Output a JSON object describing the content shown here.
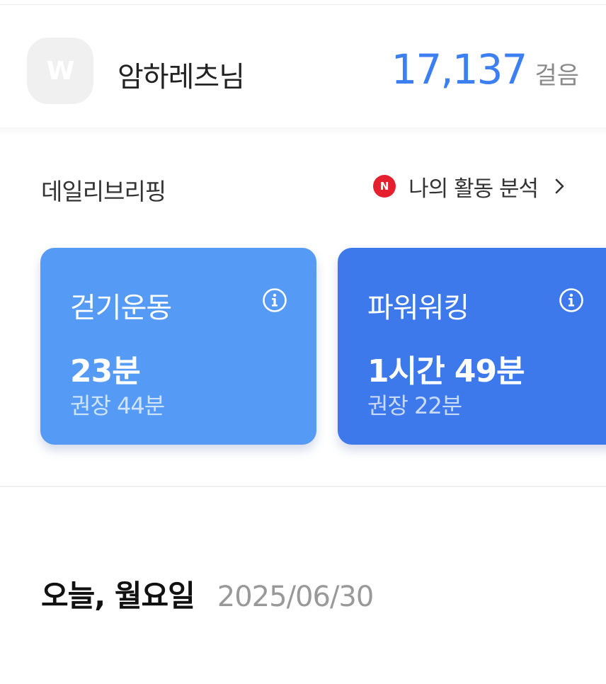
{
  "profile": {
    "avatar_letter": "W",
    "username": "암하레츠님",
    "steps_value": "17,137",
    "steps_unit": "걸음"
  },
  "briefing": {
    "title": "데일리브리핑",
    "badge": "N",
    "analysis_label": "나의 활동 분석"
  },
  "cards": [
    {
      "title": "걷기운동",
      "value": "23분",
      "recommended": "권장 44분",
      "color": "#559bf5"
    },
    {
      "title": "파워워킹",
      "value": "1시간 49분",
      "recommended": "권장 22분",
      "color": "#3d79ea"
    }
  ],
  "today": {
    "day_label": "오늘, 월요일",
    "date": "2025/06/30"
  },
  "colors": {
    "accent": "#3c7ff0",
    "badge": "#e5202e"
  }
}
